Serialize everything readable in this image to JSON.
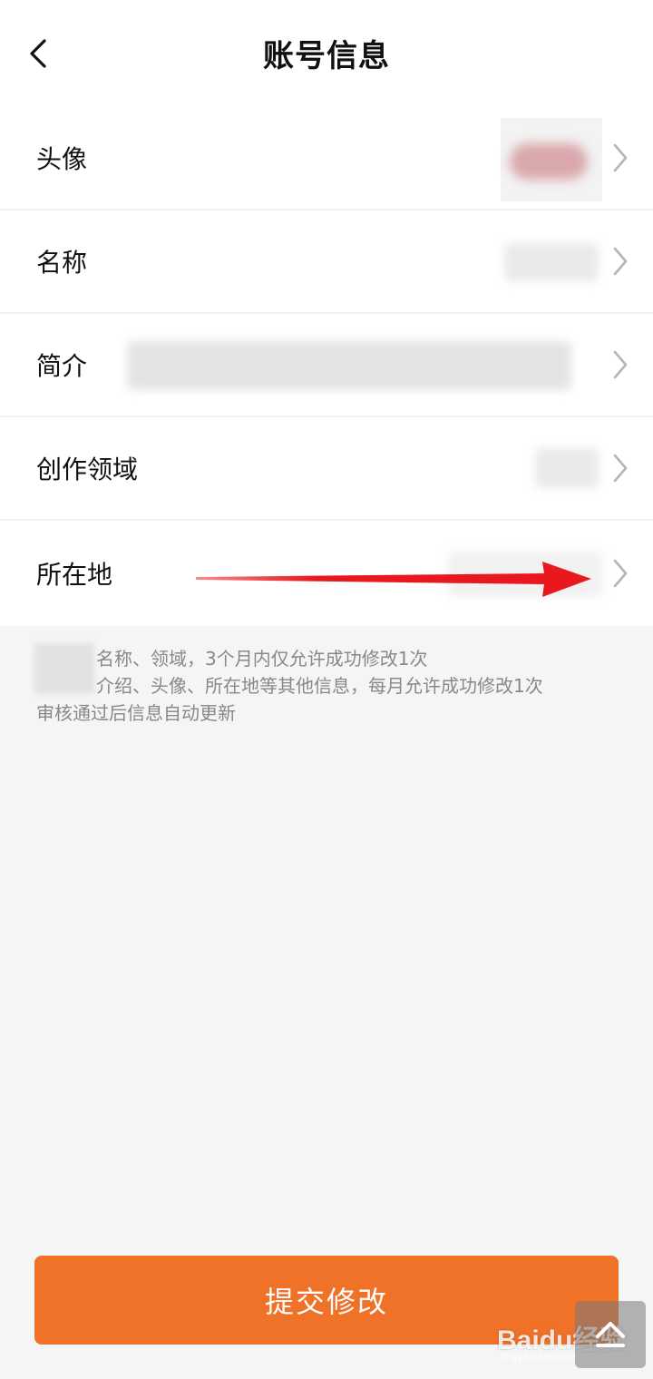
{
  "header": {
    "title": "账号信息",
    "back_icon": "chevron-left-icon"
  },
  "rows": [
    {
      "label": "头像"
    },
    {
      "label": "名称"
    },
    {
      "label": "简介"
    },
    {
      "label": "创作领域"
    },
    {
      "label": "所在地"
    }
  ],
  "hint": {
    "line1": "名称、领域，3个月内仅允许成功修改1次",
    "line2": "介绍、头像、所在地等其他信息，每月允许成功修改1次",
    "line3": "审核通过后信息自动更新"
  },
  "submit": {
    "label": "提交修改"
  },
  "watermark": {
    "text": "Baidu经验",
    "sub": "jingyan.baidu.com"
  },
  "colors": {
    "accent": "#f07128",
    "background": "#f5f5f5",
    "annotation_arrow": "#e8181e"
  }
}
